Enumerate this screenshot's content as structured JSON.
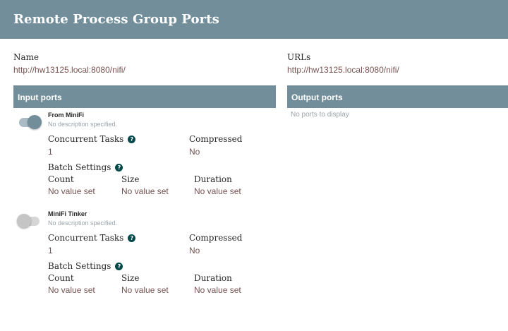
{
  "header": {
    "title": "Remote Process Group Ports"
  },
  "info": {
    "name_label": "Name",
    "name_value": "http://hw13125.local:8080/nifi/",
    "urls_label": "URLs",
    "urls_value": "http://hw13125.local:8080/nifi/"
  },
  "input_ports": {
    "title": "Input ports",
    "ports": [
      {
        "name": "From MiniFi",
        "description": "No description specified.",
        "enabled": true,
        "concurrent_tasks_label": "Concurrent Tasks",
        "concurrent_tasks_value": "1",
        "compressed_label": "Compressed",
        "compressed_value": "No",
        "batch_settings_label": "Batch Settings",
        "count_label": "Count",
        "count_value": "No value set",
        "size_label": "Size",
        "size_value": "No value set",
        "duration_label": "Duration",
        "duration_value": "No value set"
      },
      {
        "name": "MiniFi Tinker",
        "description": "No description specified.",
        "enabled": false,
        "concurrent_tasks_label": "Concurrent Tasks",
        "concurrent_tasks_value": "1",
        "compressed_label": "Compressed",
        "compressed_value": "No",
        "batch_settings_label": "Batch Settings",
        "count_label": "Count",
        "count_value": "No value set",
        "size_label": "Size",
        "size_value": "No value set",
        "duration_label": "Duration",
        "duration_value": "No value set"
      }
    ]
  },
  "output_ports": {
    "title": "Output ports",
    "empty_message": "No ports to display"
  },
  "icons": {
    "help": "question-circle-icon",
    "help_glyph": "?"
  },
  "colors": {
    "header_bg": "#728e9b",
    "value_text": "#775351",
    "help_icon": "#004849"
  }
}
